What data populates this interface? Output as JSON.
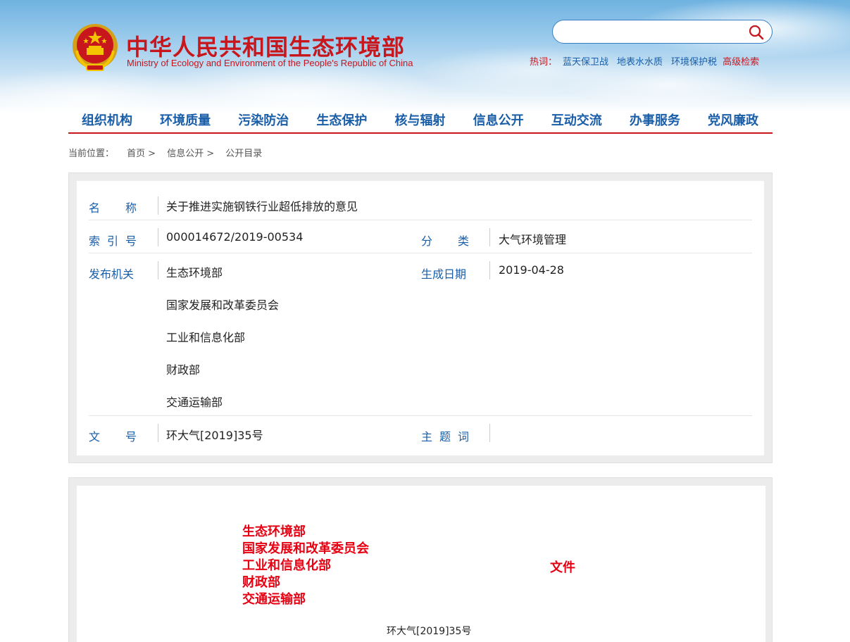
{
  "header": {
    "title_cn": "中华人民共和国生态环境部",
    "title_en": "Ministry of Ecology and Environment of the People's Republic of China",
    "search_placeholder": "",
    "hot_label": "热词：",
    "hot_words": [
      "蓝天保卫战",
      "地表水水质",
      "环境保护税"
    ],
    "advanced_search": "高级检索"
  },
  "nav": {
    "items": [
      "组织机构",
      "环境质量",
      "污染防治",
      "生态保护",
      "核与辐射",
      "信息公开",
      "互动交流",
      "办事服务",
      "党风廉政"
    ]
  },
  "breadcrumb": {
    "label": "当前位置：",
    "items": [
      "首页",
      "信息公开",
      "公开目录"
    ],
    "separator": ">"
  },
  "meta": {
    "name_label": [
      "名",
      "称"
    ],
    "name_value": "关于推进实施钢铁行业超低排放的意见",
    "index_label": [
      "索",
      "引",
      "号"
    ],
    "index_value": "000014672/2019-00534",
    "category_label": [
      "分",
      "类"
    ],
    "category_value": "大气环境管理",
    "issuer_label": "发布机关",
    "issuers": [
      "生态环境部",
      "国家发展和改革委员会",
      "工业和信息化部",
      "财政部",
      "交通运输部"
    ],
    "date_label": "生成日期",
    "date_value": "2019-04-28",
    "docno_label": [
      "文",
      "号"
    ],
    "docno_value": "环大气[2019]35号",
    "keywords_label": [
      "主",
      "题",
      "词"
    ],
    "keywords_value": ""
  },
  "document": {
    "issuers": [
      "生态环境部",
      "国家发展和改革委员会",
      "工业和信息化部",
      "财政部",
      "交通运输部"
    ],
    "doc_word": "文件",
    "doc_number": "环大气[2019]35号"
  },
  "colors": {
    "brand_red": "#c8161d",
    "link_blue": "#1a5ea8",
    "doc_red": "#e60012"
  }
}
